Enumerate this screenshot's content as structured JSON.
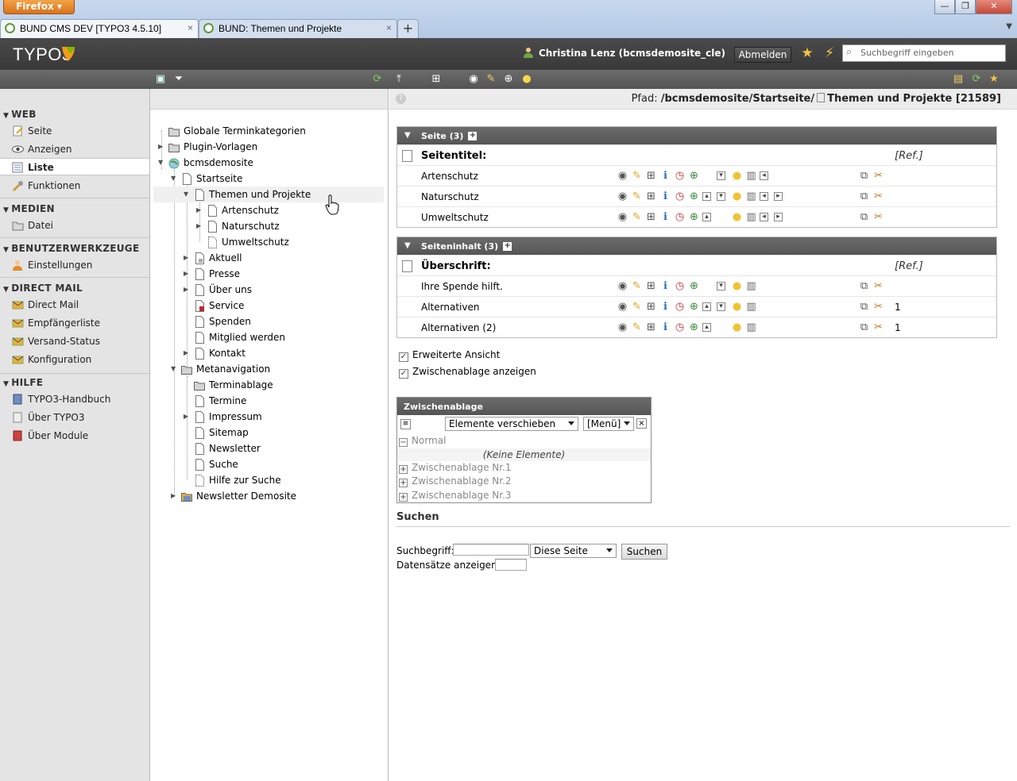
{
  "browser": {
    "app_button": "Firefox",
    "tabs": [
      {
        "title": "BUND CMS DEV [TYPO3 4.5.10]",
        "active": true
      },
      {
        "title": "BUND: Themen und Projekte",
        "active": false
      }
    ],
    "new_tab": "+",
    "close": "×"
  },
  "header": {
    "logo": "TYPO3",
    "user": "Christina Lenz (bcmsdemosite_cle)",
    "logout": "Abmelden",
    "search_placeholder": "Suchbegriff eingeben"
  },
  "modules": [
    {
      "section": "WEB",
      "items": [
        "Seite",
        "Anzeigen",
        "Liste",
        "Funktionen"
      ],
      "active": "Liste"
    },
    {
      "section": "MEDIEN",
      "items": [
        "Datei"
      ]
    },
    {
      "section": "BENUTZERWERKZEUGE",
      "items": [
        "Einstellungen"
      ]
    },
    {
      "section": "DIRECT MAIL",
      "items": [
        "Direct Mail",
        "Empfängerliste",
        "Versand-Status",
        "Konfiguration"
      ]
    },
    {
      "section": "HILFE",
      "items": [
        "TYPO3-Handbuch",
        "Über TYPO3",
        "Über Module"
      ]
    }
  ],
  "tree": [
    "Globale Terminkategorien",
    "Plugin-Vorlagen",
    "bcmsdemosite",
    "Startseite",
    "Themen und Projekte",
    "Artenschutz",
    "Naturschutz",
    "Umweltschutz",
    "Aktuell",
    "Presse",
    "Über uns",
    "Service",
    "Spenden",
    "Mitglied werden",
    "Kontakt",
    "Metanavigation",
    "Terminablage",
    "Termine",
    "Impressum",
    "Sitemap",
    "Newsletter",
    "Suche",
    "Hilfe zur Suche",
    "Newsletter Demosite"
  ],
  "path": {
    "label": "Pfad:",
    "value": "/bcmsdemosite/Startseite/",
    "page": "Themen und Projekte [21589]"
  },
  "tables": {
    "pages": {
      "header": "Seite (3)",
      "title_col": "Seitentitel:",
      "ref_col": "[Ref.]",
      "rows": [
        "Artenschutz",
        "Naturschutz",
        "Umweltschutz"
      ]
    },
    "content": {
      "header": "Seiteninhalt (3)",
      "title_col": "Überschrift:",
      "ref_col": "[Ref.]",
      "rows": [
        {
          "title": "Ihre Spende hilft.",
          "count": ""
        },
        {
          "title": "Alternativen",
          "count": "1"
        },
        {
          "title": "Alternativen (2)",
          "count": "1"
        }
      ]
    }
  },
  "options": {
    "extended_view": "Erweiterte Ansicht",
    "show_clipboard": "Zwischenablage anzeigen"
  },
  "clipboard": {
    "title": "Zwischenablage",
    "action": "Elemente verschieben",
    "mode": "[Menü]",
    "normal": "Normal",
    "empty": "(Keine Elemente)",
    "pads": [
      "Zwischenablage Nr.1",
      "Zwischenablage Nr.2",
      "Zwischenablage Nr.3"
    ]
  },
  "search": {
    "heading": "Suchen",
    "term_label": "Suchbegriff:",
    "scope": "Diese Seite",
    "button": "Suchen",
    "records_label": "Datensätze anzeigen:"
  },
  "colors": {
    "header_bg": "#393939",
    "toolbar_bg": "#5f5f5f",
    "module_bg": "#e4e4e4",
    "accent_orange": "#f39c12"
  }
}
